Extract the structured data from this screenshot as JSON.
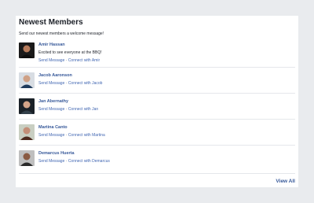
{
  "panel": {
    "title": "Newest Members",
    "subtitle": "Send our newest members a welcome message!",
    "view_all": "View All"
  },
  "members": [
    {
      "name": "Amir Hassan",
      "status": "Excited to see everyone at the BBQ!",
      "send_message": "Send Message",
      "separator": "·",
      "connect": "Connect with Amir",
      "avatar_colors": {
        "bg": "#1a1a1a",
        "face": "#b57a5a",
        "shirt": "#0d0d0d"
      }
    },
    {
      "name": "Jacob Aaronson",
      "status": "",
      "send_message": "Send Message",
      "separator": "·",
      "connect": "Connect with Jacob",
      "avatar_colors": {
        "bg": "#d8dde3",
        "face": "#cfa186",
        "shirt": "#1f3b5c"
      }
    },
    {
      "name": "Jan Abernathy",
      "status": "",
      "send_message": "Send Message",
      "separator": "·",
      "connect": "Connect with Jan",
      "avatar_colors": {
        "bg": "#1a2128",
        "face": "#d4a489",
        "shirt": "#33404a"
      }
    },
    {
      "name": "Martina Canto",
      "status": "",
      "send_message": "Send Message",
      "separator": "·",
      "connect": "Connect with Martina",
      "avatar_colors": {
        "bg": "#c9cfc2",
        "face": "#c38f78",
        "shirt": "#4d2a1e"
      }
    },
    {
      "name": "Demarcus Huerta",
      "status": "",
      "send_message": "Send Message",
      "separator": "·",
      "connect": "Connect with Demarcus",
      "avatar_colors": {
        "bg": "#bfbfbf",
        "face": "#8a5a42",
        "shirt": "#2b2b2b"
      }
    }
  ]
}
